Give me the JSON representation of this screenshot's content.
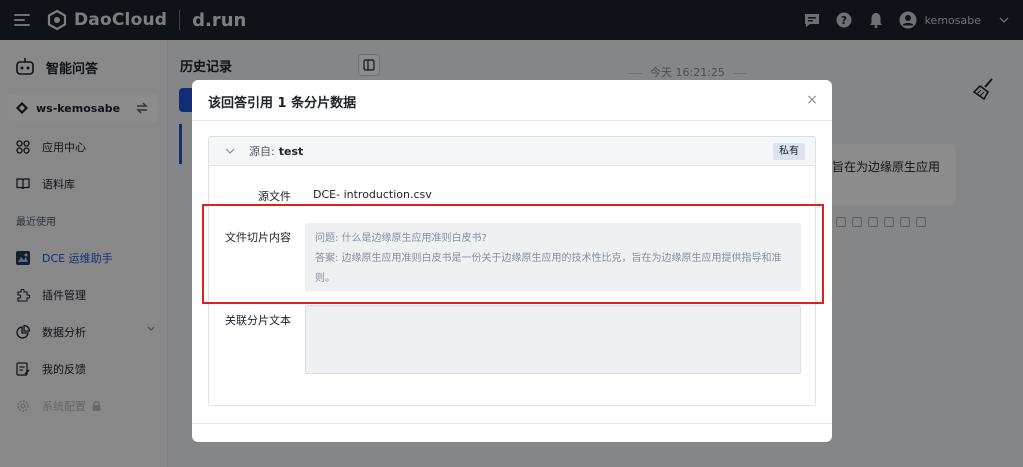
{
  "topbar": {
    "brand": "DaoCloud",
    "product": "d.run",
    "username": "kemosabe"
  },
  "sidebar": {
    "title": "智能问答",
    "workspace": "ws-kemosabe",
    "items": [
      {
        "label": "应用中心"
      },
      {
        "label": "语料库"
      }
    ],
    "recent_label": "最近使用",
    "recent_items": [
      {
        "label": "DCE 运维助手"
      },
      {
        "label": "插件管理"
      },
      {
        "label": "数据分析"
      },
      {
        "label": "我的反馈"
      },
      {
        "label": "系统配置"
      }
    ]
  },
  "history": {
    "title": "历史记录"
  },
  "chat": {
    "timestamp": "今天 16:21:25",
    "bubble_text": "旨在为边缘原生应用"
  },
  "modal": {
    "title": "该回答引用 1 条分片数据",
    "close_symbol": "×",
    "source_prefix": "源自:",
    "source_name": "test",
    "tag": "私有",
    "file_label": "源文件",
    "file_value": "DCE- introduction.csv",
    "content_label": "文件切片内容",
    "content_question": "问题: 什么是边缘原生应用准则白皮书?",
    "content_answer": "答案: 边缘原生应用准则白皮书是一份关于边缘原生应用的技术性比克，旨在为边缘原生应用提供指导和准则。",
    "related_label": "关联分片文本"
  },
  "colors": {
    "accent": "#1f54d6",
    "highlight": "#e0201f",
    "topbar": "#1d2129"
  }
}
